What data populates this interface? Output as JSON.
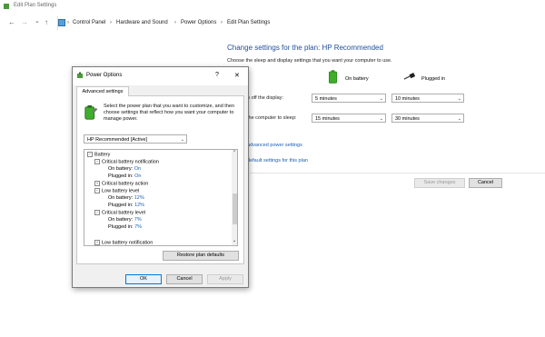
{
  "window": {
    "title": "Edit Plan Settings"
  },
  "nav": {
    "back": "←",
    "forward": "→",
    "down": "⌄",
    "up": "↑"
  },
  "breadcrumb": [
    "Control Panel",
    "Hardware and Sound",
    "Power Options",
    "Edit Plan Settings"
  ],
  "plan": {
    "heading": "Change settings for the plan: HP Recommended",
    "subtitle": "Choose the sleep and display settings that you want your computer to use.",
    "col_battery": "On battery",
    "col_plugged": "Plugged in",
    "row_display_label": "n off the display:",
    "row_sleep_label": "the computer to sleep:",
    "display_battery": "5 minutes",
    "display_plugged": "10 minutes",
    "sleep_battery": "15 minutes",
    "sleep_plugged": "30 minutes",
    "link_advanced": "advanced power settings",
    "link_restore": "default settings for this plan",
    "save_label": "Save changes",
    "cancel_label": "Cancel"
  },
  "dialog": {
    "title": "Power Options",
    "help": "?",
    "close": "✕",
    "tab": "Advanced settings",
    "description": "Select the power plan that you want to customize, and then choose settings that reflect how you want your computer to manage power.",
    "plan_select": "HP Recommended [Active]",
    "tree": {
      "battery": "Battery",
      "crit_notif": "Critical battery notification",
      "crit_notif_on_battery_label": "On battery:",
      "crit_notif_on_battery_value": "On",
      "crit_notif_plugged_label": "Plugged in:",
      "crit_notif_plugged_value": "On",
      "crit_action": "Critical battery action",
      "low_level": "Low battery level",
      "low_level_on_battery_label": "On battery:",
      "low_level_on_battery_value": "12%",
      "low_level_plugged_label": "Plugged in:",
      "low_level_plugged_value": "12%",
      "crit_level": "Critical battery level",
      "crit_level_on_battery_label": "On battery:",
      "crit_level_on_battery_value": "7%",
      "crit_level_plugged_label": "Plugged in:",
      "crit_level_plugged_value": "7%",
      "low_notif": "Low battery notification"
    },
    "restore_defaults": "Restore plan defaults",
    "ok": "OK",
    "cancel": "Cancel",
    "apply": "Apply"
  },
  "colors": {
    "accent": "#1f4e9b",
    "link": "#1a5fb4",
    "battery_green": "#3fae2a"
  }
}
